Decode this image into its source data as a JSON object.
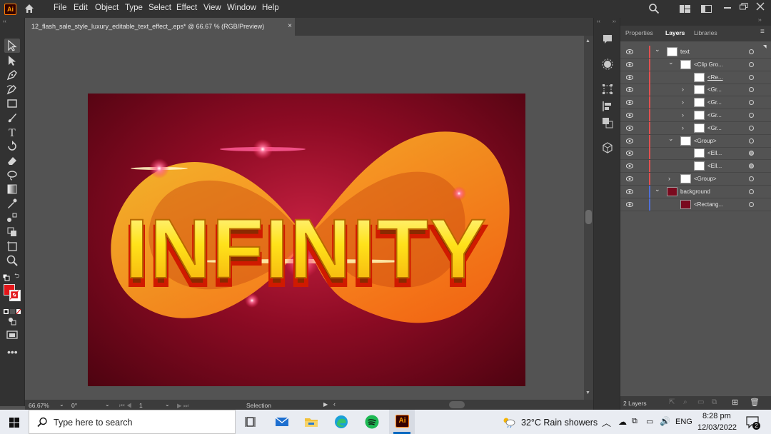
{
  "menubar": {
    "app_logo": "Ai",
    "items": [
      "File",
      "Edit",
      "Object",
      "Type",
      "Select",
      "Effect",
      "View",
      "Window",
      "Help"
    ]
  },
  "document": {
    "tab_title": "12_flash_sale_style_luxury_editable_text_effect_.eps* @ 66.67 % (RGB/Preview)",
    "close_glyph": "×"
  },
  "artwork": {
    "headline": "INFINITY"
  },
  "statusbar": {
    "zoom": "66.67%",
    "rotation": "0°",
    "artboard_number": "1",
    "tool_status": "Selection"
  },
  "panel": {
    "tabs": [
      "Properties",
      "Layers",
      "Libraries"
    ],
    "active_tab": "Layers",
    "layers": [
      {
        "name": "text",
        "indent": 0,
        "chev": "down",
        "color": "#e25050"
      },
      {
        "name": "<Clip Gro...",
        "indent": 1,
        "chev": "down",
        "color": "#e25050"
      },
      {
        "name": "<Re...",
        "indent": 2,
        "chev": "",
        "color": "#e25050",
        "underline": true
      },
      {
        "name": "<Gr...",
        "indent": 2,
        "chev": "right",
        "color": "#e25050"
      },
      {
        "name": "<Gr...",
        "indent": 2,
        "chev": "right",
        "color": "#e25050"
      },
      {
        "name": "<Gr...",
        "indent": 2,
        "chev": "right",
        "color": "#e25050"
      },
      {
        "name": "<Gr...",
        "indent": 2,
        "chev": "right",
        "color": "#e25050"
      },
      {
        "name": "<Group>",
        "indent": 1,
        "chev": "down",
        "color": "#e25050"
      },
      {
        "name": "<Ell...",
        "indent": 2,
        "chev": "",
        "color": "#e25050",
        "filled": true
      },
      {
        "name": "<Ell...",
        "indent": 2,
        "chev": "",
        "color": "#e25050",
        "filled": true
      },
      {
        "name": "<Group>",
        "indent": 1,
        "chev": "right",
        "color": "#e25050"
      },
      {
        "name": "background",
        "indent": 0,
        "chev": "down",
        "color": "#4f6fd8"
      },
      {
        "name": "<Rectang...",
        "indent": 1,
        "chev": "",
        "color": "#4f6fd8"
      }
    ],
    "footer_count": "2 Layers"
  },
  "taskbar": {
    "search_placeholder": "Type here to search",
    "weather": "32°C  Rain showers",
    "language": "ENG",
    "time": "8:28 pm",
    "date": "12/03/2022",
    "notification_count": "2"
  }
}
